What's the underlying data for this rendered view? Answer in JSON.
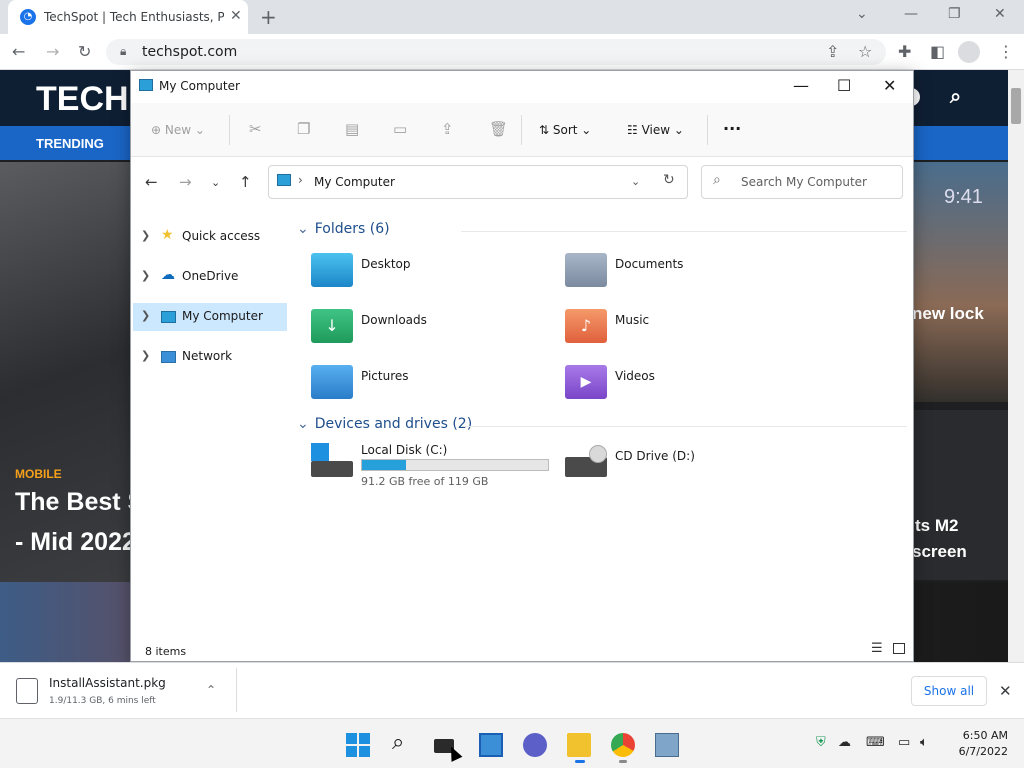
{
  "browser": {
    "tab_title": "TechSpot | Tech Enthusiasts, Power",
    "url": "techspot.com",
    "new_tab": "+"
  },
  "webpage": {
    "logo": "TECH",
    "nav_trending": "TRENDING",
    "category": "MOBILE",
    "headline_line1": "The Best S",
    "headline_line2": "- Mid 2022",
    "right_text1": "new lock",
    "right_text2": "ts M2",
    "right_text3": "screen",
    "right_time": "9:41"
  },
  "explorer": {
    "title": "My Computer",
    "toolbar": {
      "new_label": "New",
      "sort_label": "Sort",
      "view_label": "View",
      "more_label": "···"
    },
    "address": "My Computer",
    "address_sep": "›",
    "search_placeholder": "Search My Computer",
    "nav_pane": [
      {
        "label": "Quick access",
        "icon": "star-icon"
      },
      {
        "label": "OneDrive",
        "icon": "cloud-icon"
      },
      {
        "label": "My Computer",
        "icon": "computer-icon",
        "selected": true
      },
      {
        "label": "Network",
        "icon": "network-icon"
      }
    ],
    "folders_header": "Folders (6)",
    "folders": [
      {
        "name": "Desktop",
        "color": "#2b9fd8"
      },
      {
        "name": "Documents",
        "color": "#8c9bb0"
      },
      {
        "name": "Downloads",
        "color": "#2ea86a"
      },
      {
        "name": "Music",
        "color": "#e8744a"
      },
      {
        "name": "Pictures",
        "color": "#3a8fd6"
      },
      {
        "name": "Videos",
        "color": "#8e5bd6"
      }
    ],
    "drives_header": "Devices and drives (2)",
    "drives": [
      {
        "name": "Local Disk (C:)",
        "free_text": "91.2 GB free of 119 GB",
        "used_fraction": 0.234
      },
      {
        "name": "CD Drive (D:)"
      }
    ],
    "status_items": "8 items"
  },
  "download": {
    "filename": "InstallAssistant.pkg",
    "status": "1.9/11.3 GB, 6 mins left",
    "show_all": "Show all"
  },
  "taskbar": {
    "time": "6:50 AM",
    "date": "6/7/2022"
  }
}
